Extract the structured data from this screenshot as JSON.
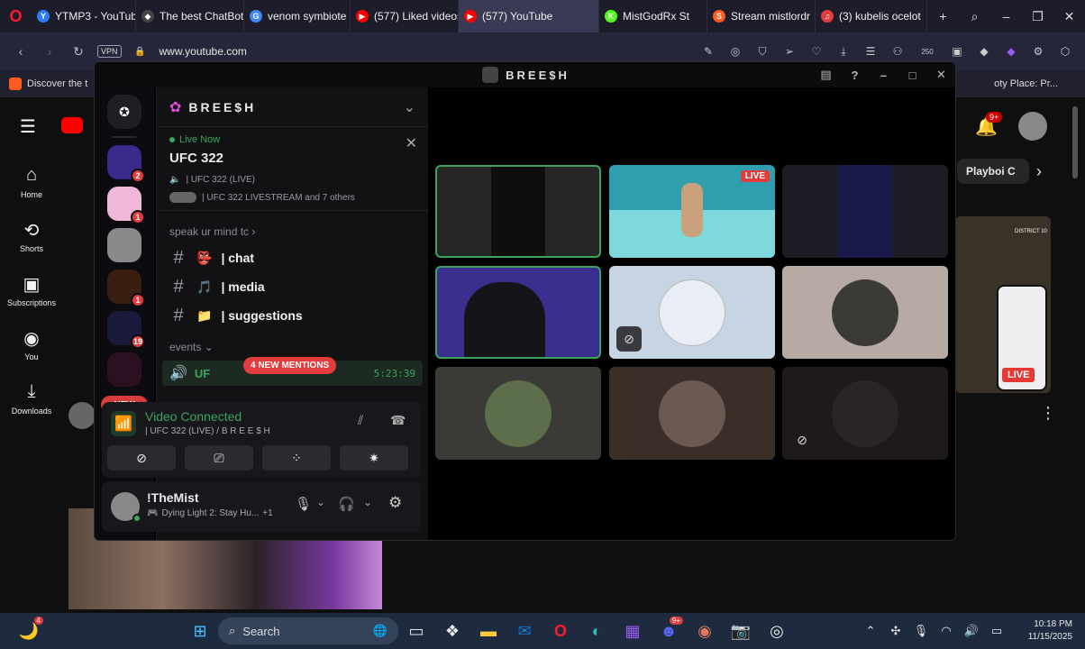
{
  "browser": {
    "tabs": [
      {
        "label": "YTMP3 - YouTube",
        "color": "#2d7df6",
        "glyph": "Y"
      },
      {
        "label": "The best ChatBot",
        "color": "#444",
        "glyph": "◆"
      },
      {
        "label": "venom symbiote",
        "color": "#4285f4",
        "glyph": "G"
      },
      {
        "label": "(577) Liked videos",
        "color": "#ff0000",
        "glyph": "▶"
      },
      {
        "label": "(577) YouTube",
        "color": "#ff0000",
        "glyph": "▶"
      },
      {
        "label": "MistGodRx St",
        "color": "#53fc18",
        "glyph": "K"
      },
      {
        "label": "Stream mistlordr",
        "color": "#ff5a1f",
        "glyph": "S"
      },
      {
        "label": "(3) kubelis ocelot",
        "color": "#e23c3c",
        "glyph": "♫"
      }
    ],
    "vpn": "VPN",
    "url": "www.youtube.com",
    "ext_badge": "250",
    "bookmark_left": "Discover the t",
    "bookmark_right": "oty Place: Pr..."
  },
  "youtube": {
    "nav": [
      {
        "label": "Home",
        "icon": "home-icon"
      },
      {
        "label": "Shorts",
        "icon": "shorts-icon"
      },
      {
        "label": "Subscriptions",
        "icon": "subscriptions-icon"
      },
      {
        "label": "You",
        "icon": "you-icon"
      },
      {
        "label": "Downloads",
        "icon": "downloads-icon"
      }
    ],
    "notif_badge": "9+",
    "chip_label": "Playboi C",
    "live_label": "LIVE",
    "district_label": "DISTRICT 10"
  },
  "discord": {
    "window_title": "BREE$H",
    "server_name": "BREE$H",
    "live_now": "Live Now",
    "event_title": "UFC 322",
    "event_stage": "| UFC 322 (LIVE)",
    "event_people": "| UFC 322 LIVESTREAM and 7 others",
    "category_1": "speak ur mind tc",
    "channels": [
      {
        "name": "| chat",
        "emoji": "👺"
      },
      {
        "name": "| media",
        "emoji": "🎵"
      },
      {
        "name": "| suggestions",
        "emoji": "📁"
      }
    ],
    "category_2": "events",
    "voice_channel_short": "UF",
    "new_mentions": "4 NEW MENTIONS",
    "timer": "5:23:39",
    "new_pill": "NEW",
    "server_badges": [
      "2",
      "1",
      "",
      "1",
      "19"
    ],
    "video_connected": "Video Connected",
    "voice_location": "| UFC 322 (LIVE) / B R E E $ H",
    "username": "!TheMist",
    "activity": "Dying Light 2: Stay Hu...",
    "activity_extra": "+1",
    "live_badge": "LIVE"
  },
  "taskbar": {
    "search": "Search",
    "time": "10:18 PM",
    "date": "11/15/2025",
    "discord_badge": "9+",
    "start_badge": "4"
  }
}
